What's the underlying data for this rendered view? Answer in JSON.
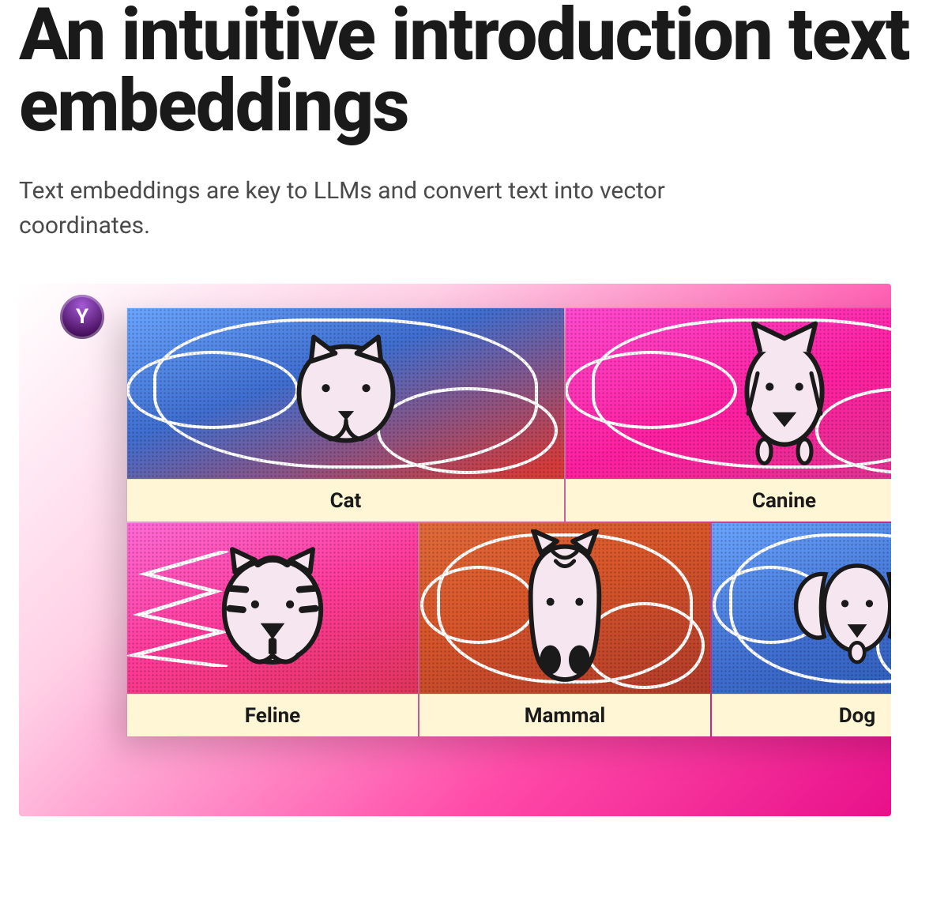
{
  "article": {
    "title": "An intuitive introduction text embeddings",
    "subtitle": "Text embeddings are key to LLMs and convert text into vector coordinates."
  },
  "hero": {
    "badge_letter": "Y",
    "tiles": {
      "cat": {
        "label": "Cat"
      },
      "canine": {
        "label": "Canine"
      },
      "feline": {
        "label": "Feline"
      },
      "mammal": {
        "label": "Mammal"
      },
      "dog": {
        "label": "Dog"
      }
    }
  }
}
